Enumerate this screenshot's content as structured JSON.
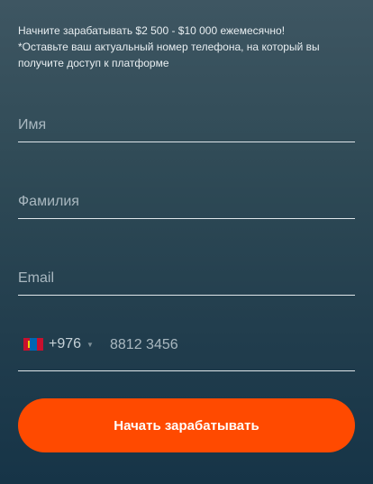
{
  "intro": {
    "line1": "Начните зарабатывать $2 500 - $10 000 ежемесячно!",
    "line2": "*Оставьте ваш актуальный номер телефона, на который вы получите доступ к платформе"
  },
  "form": {
    "first_name_placeholder": "Имя",
    "last_name_placeholder": "Фамилия",
    "email_placeholder": "Email",
    "country_code": "+976",
    "country_flag": "mongolia-flag",
    "phone_placeholder": "8812 3456",
    "submit_label": "Начать зарабатывать"
  },
  "colors": {
    "accent": "#ff4a00",
    "background_top": "#3e5662",
    "background_bottom": "#163447"
  }
}
